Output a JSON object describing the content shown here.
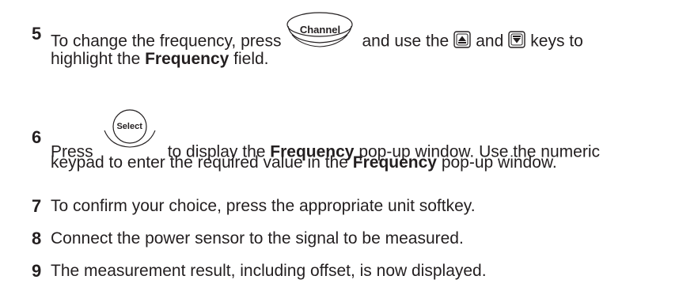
{
  "steps": [
    {
      "number": "5",
      "text_a": "To change the frequency, press",
      "key_channel_label": "Channel",
      "text_b": "and use the",
      "text_c": "and",
      "text_d": "keys to",
      "line2_a": "highlight the",
      "line2_bold": "Frequency",
      "line2_b": "field."
    },
    {
      "number": "6",
      "text_a": "Press",
      "key_select_label": "Select",
      "text_b": "to display the",
      "bold_1": "Frequency",
      "text_c": "pop-up window. Use the numeric",
      "line2_a": "keypad to enter the required value in the",
      "line2_bold": "Frequency",
      "line2_b": "pop-up window."
    },
    {
      "number": "7",
      "text": "To confirm your choice, press the appropriate unit softkey."
    },
    {
      "number": "8",
      "text": "Connect the power sensor to the signal to be measured."
    },
    {
      "number": "9",
      "text": "The measurement result, including offset, is now displayed."
    }
  ],
  "icons": {
    "up_arrow": "up-arrow-key-icon",
    "down_arrow": "down-arrow-key-icon"
  }
}
